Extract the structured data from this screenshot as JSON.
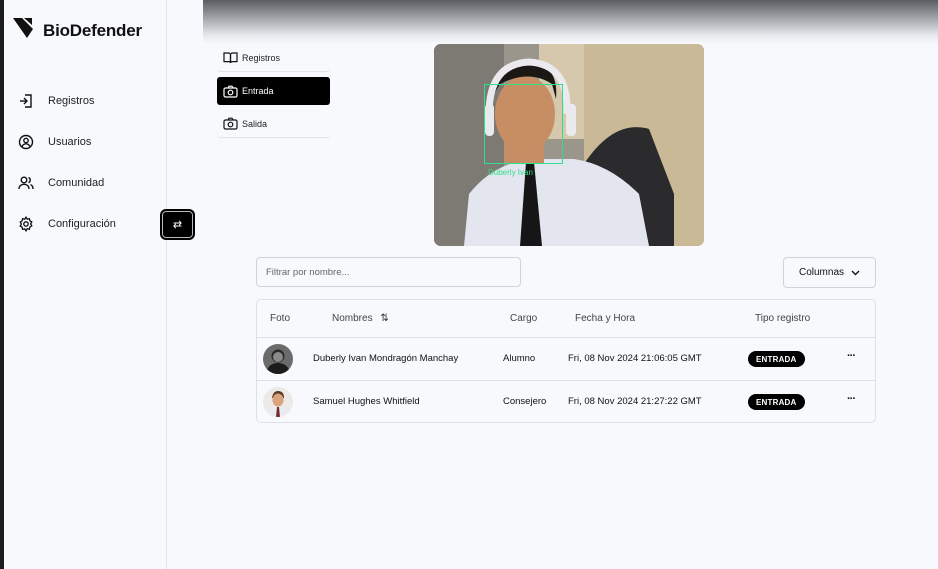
{
  "brand": {
    "name": "BioDefender",
    "logo_icon": "biodefender-logo-icon"
  },
  "sidebar": {
    "items": [
      {
        "label": "Registros",
        "icon": "login-icon"
      },
      {
        "label": "Usuarios",
        "icon": "user-circle-icon"
      },
      {
        "label": "Comunidad",
        "icon": "users-icon"
      },
      {
        "label": "Configuración",
        "icon": "gear-icon"
      }
    ],
    "toggle_glyph": "⇄"
  },
  "subtabs": [
    {
      "label": "Registros",
      "icon": "book-open-icon",
      "active": false
    },
    {
      "label": "Entrada",
      "icon": "camera-icon",
      "active": true
    },
    {
      "label": "Salida",
      "icon": "camera-icon",
      "active": false
    }
  ],
  "camera": {
    "detected_label": "Duberly Ivan",
    "box_color": "#2ee08a"
  },
  "filter": {
    "placeholder": "Filtrar por nombre...",
    "value": ""
  },
  "columns_button": {
    "label": "Columnas"
  },
  "table": {
    "headers": {
      "photo": "Foto",
      "name": "Nombres",
      "role": "Cargo",
      "datetime": "Fecha y Hora",
      "type": "Tipo registro"
    },
    "sort_glyph": "⇅",
    "more_glyph": "···",
    "rows": [
      {
        "name": "Duberly Ivan Mondragón Manchay",
        "role": "Alumno",
        "datetime": "Fri, 08 Nov 2024 21:06:05 GMT",
        "type": "ENTRADA"
      },
      {
        "name": "Samuel Hughes Whitfield",
        "role": "Consejero",
        "datetime": "Fri, 08 Nov 2024 21:27:22 GMT",
        "type": "ENTRADA"
      }
    ]
  },
  "colors": {
    "accent": "#000000",
    "background": "#f7f9fc",
    "border": "#dde1e7"
  }
}
